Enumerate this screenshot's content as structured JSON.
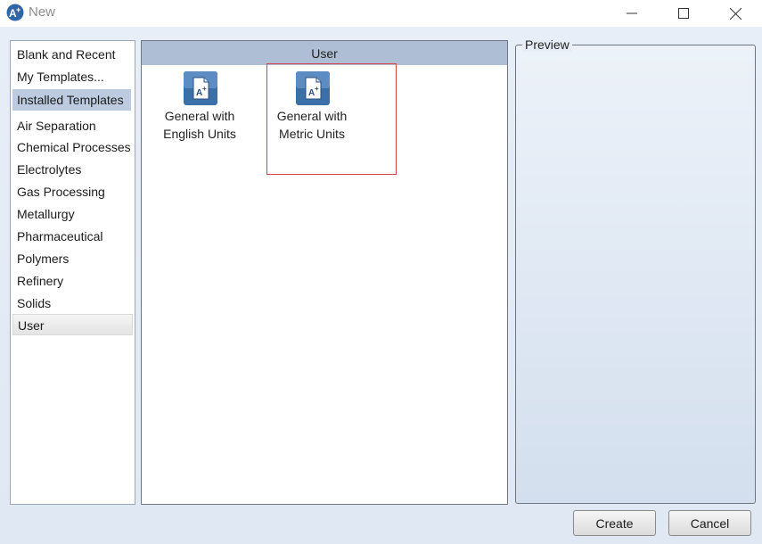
{
  "window": {
    "title": "New",
    "app_icon": "aspen-plus-icon",
    "controls": [
      "minimize-icon",
      "maximize-icon",
      "close-icon"
    ]
  },
  "categories": [
    {
      "label": "Blank and Recent"
    },
    {
      "label": "My Templates..."
    },
    {
      "label": "Installed Templates",
      "state": "selected-group"
    },
    {
      "label": "Air Separation"
    },
    {
      "label": "Chemical Processes"
    },
    {
      "label": "Electrolytes"
    },
    {
      "label": "Gas Processing"
    },
    {
      "label": "Metallurgy"
    },
    {
      "label": "Pharmaceutical"
    },
    {
      "label": "Polymers"
    },
    {
      "label": "Refinery"
    },
    {
      "label": "Solids"
    },
    {
      "label": "User",
      "state": "selected"
    }
  ],
  "templates": {
    "group_header": "User",
    "items": [
      {
        "label": "General with\nEnglish Units",
        "icon": "template-document-icon"
      },
      {
        "label": "General with\nMetric Units",
        "icon": "template-document-icon",
        "highlighted": true
      }
    ]
  },
  "preview": {
    "label": "Preview"
  },
  "buttons": {
    "create": "Create",
    "cancel": "Cancel"
  },
  "colors": {
    "header_bg": "#aebed5",
    "selected_bg": "#bccbe0",
    "highlight_border": "#d9434e",
    "icon_blue": "#3a6fa8"
  }
}
